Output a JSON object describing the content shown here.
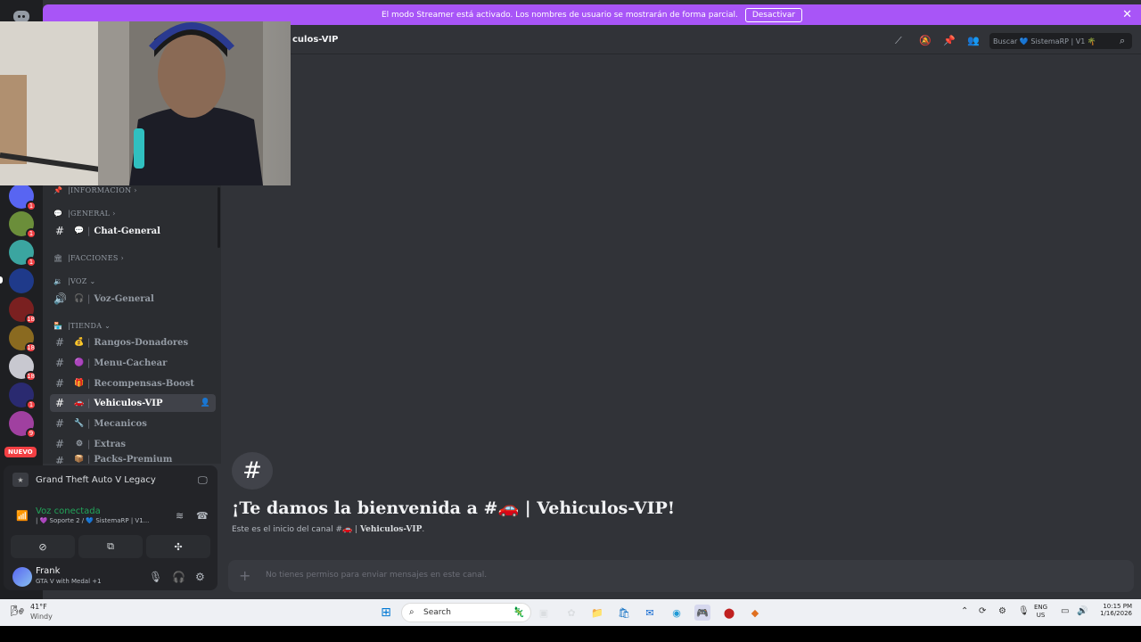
{
  "banner": {
    "text": "El modo Streamer está activado. Los nombres de usuario se mostrarán de forma parcial.",
    "button": "Desactivar",
    "close": "✕"
  },
  "rail": {
    "badges": [
      "1",
      "1",
      "1",
      "18",
      "18",
      "18",
      "1",
      "9"
    ],
    "nuevo": "NUEVO"
  },
  "channels": {
    "categories": {
      "informacion": "INFORMACION",
      "general": "GENERAL",
      "facciones": "FACCIONES",
      "voz": "VOZ",
      "tienda": "TIENDA"
    },
    "items": [
      {
        "name": "Chat-General",
        "emoji": "💬"
      },
      {
        "name": "Voz-General",
        "emoji": "🎧"
      },
      {
        "name": "Rangos-Donadores",
        "emoji": "💰"
      },
      {
        "name": "Menu-Cachear",
        "emoji": "🟣"
      },
      {
        "name": "Recompensas-Boost",
        "emoji": "🎁"
      },
      {
        "name": "Vehiculos-VIP",
        "emoji": "🚗"
      },
      {
        "name": "Mecanicos",
        "emoji": "🔧"
      },
      {
        "name": "Extras",
        "emoji": "⚙"
      },
      {
        "name": "Packs-Premium",
        "emoji": "📦"
      }
    ]
  },
  "panel": {
    "game": "Grand Theft Auto V Legacy",
    "voice_status": "Voz conectada",
    "voice_sub": "| 💜 Soporte 2 / 💙 SistemaRP | V1...",
    "username": "Frank",
    "user_status": "GTA V with Medal +1"
  },
  "header": {
    "title": "culos-VIP",
    "search": "Buscar 💙 SistemaRP | V1 🌴"
  },
  "welcome": {
    "title": "¡Te damos la bienvenida a #🚗 | Vehiculos-VIP!",
    "sub_prefix": "Este es el inicio del canal #🚗 |",
    "sub_channel": "Vehiculos-VIP",
    "sub_suffix": "."
  },
  "composer": {
    "placeholder": "No tienes permiso para enviar mensajes en este canal."
  },
  "taskbar": {
    "temp": "41°F",
    "weather": "Windy",
    "search": "Search",
    "lang1": "ENG",
    "lang2": "US",
    "time": "10:15 PM",
    "date": "1/16/2026"
  }
}
